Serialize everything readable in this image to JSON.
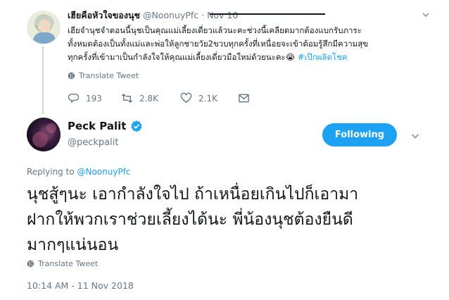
{
  "parent_tweet": {
    "author_name": "เฮียคือหัวใจของนุช",
    "author_handle": "@NoonuyPfc · Nov 10",
    "text_lines": [
      "เฮียจำนุชจำตอนนี้นุชเป็นคุณแม่เลี้ยงเดี่ยวแล้วนะคะช่วงนี้เคลียดมากต้องแบกรับภาระ",
      "ทั้งหมดต้องเป็นทั้งแม่และพ่อให้ลูกชายวัย2ขวบทุกครั้งที่เหนื่อยจะเข้าต้อมรู้สึกมีความสุข",
      "ทุกครั้งที่เข้ามาเป็นกำลังใจให้คุณแม่เลี้ยงเดี่ยวมือใหม่ด้วยนะคะ😭 "
    ],
    "hashtag": "#เป๊กผลิตโชค",
    "translate_label": "Translate Tweet",
    "replies": "193",
    "retweets": "2.8K",
    "likes": "2.1K"
  },
  "main_tweet": {
    "author_name": "Peck Palit",
    "author_handle": "@peckpalit",
    "follow_label": "Following",
    "replying_prefix": "Replying to ",
    "replying_to": "@NoonuyPfc",
    "text_lines": [
      "นุชสู้ๆนะ เอากำลังใจไป ถ้าเหนื่อยเกินไปก็เอามา",
      "ฝากให้พวกเราช่วยเลี้ยงได้นะ พี่น้องนุชต้องยืนดี",
      "มากๆแน่นอน"
    ],
    "translate_label": "Translate Tweet",
    "timestamp": "10:14 AM - 11 Nov 2018"
  },
  "colors": {
    "accent": "#1da1f2",
    "text": "#14171a",
    "muted": "#657786"
  },
  "icons": [
    "chevron-down-icon",
    "globe-icon",
    "reply-icon",
    "retweet-icon",
    "like-icon",
    "message-icon",
    "verified-badge-icon"
  ]
}
